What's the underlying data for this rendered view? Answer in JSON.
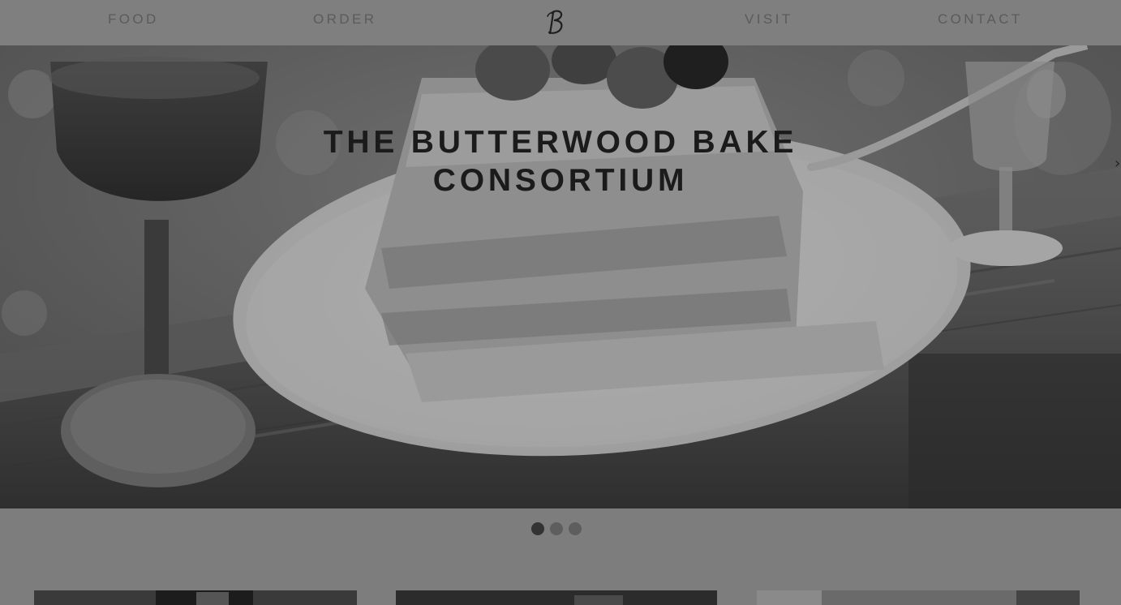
{
  "nav": {
    "food": "FOOD",
    "order": "ORDER",
    "visit": "VISIT",
    "contact": "CONTACT",
    "logo_icon": "script-b-logo-icon"
  },
  "hero": {
    "title_line1": "THE BUTTERWOOD BAKE",
    "title_line2": "CONSORTIUM",
    "next_icon": "chevron-right-icon"
  },
  "carousel": {
    "slide_count": 3,
    "active_index": 0
  },
  "colors": {
    "overlay": "#7f7f7f",
    "title": "#1b1b1b",
    "nav_text": "#5b5b5b",
    "dot_active": "#333333",
    "dot_inactive": "#5e5e5e"
  }
}
